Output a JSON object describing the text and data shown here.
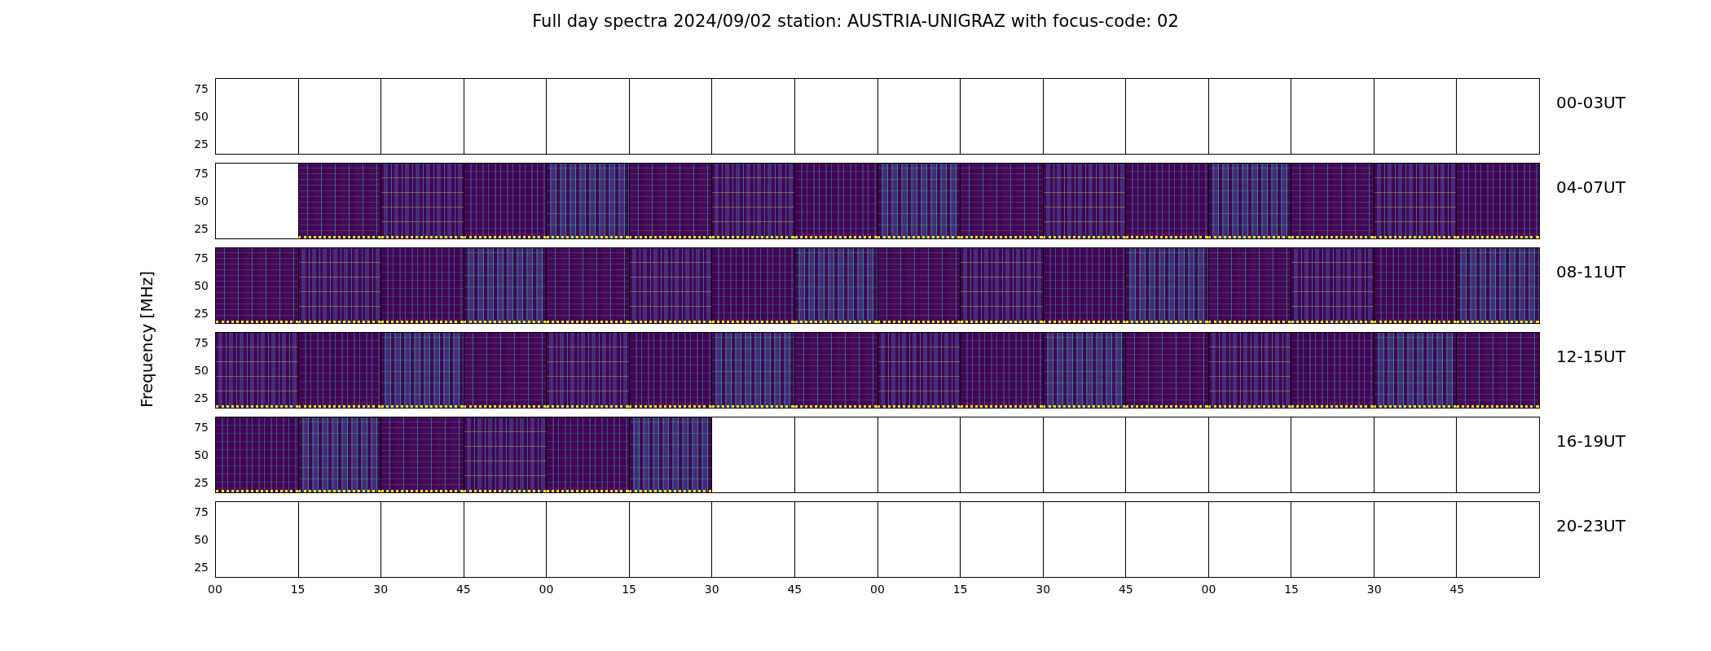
{
  "title": "Full day spectra 2024/09/02 station: AUSTRIA-UNIGRAZ with focus-code: 02",
  "ylabel": "Frequency [MHz]",
  "xticks": [
    "00",
    "15",
    "30",
    "45",
    "00",
    "15",
    "30",
    "45",
    "00",
    "15",
    "30",
    "45",
    "00",
    "15",
    "30",
    "45"
  ],
  "rows": [
    {
      "label": "00-03UT",
      "yticks": [
        "75",
        "50",
        "25"
      ],
      "panels": [
        false,
        false,
        false,
        false,
        false,
        false,
        false,
        false,
        false,
        false,
        false,
        false,
        false,
        false,
        false,
        false
      ]
    },
    {
      "label": "04-07UT",
      "yticks": [
        "75",
        "50",
        "25"
      ],
      "panels": [
        false,
        true,
        true,
        true,
        true,
        true,
        true,
        true,
        true,
        true,
        true,
        true,
        true,
        true,
        true,
        true
      ]
    },
    {
      "label": "08-11UT",
      "yticks": [
        "75",
        "50",
        "25"
      ],
      "panels": [
        true,
        true,
        true,
        true,
        true,
        true,
        true,
        true,
        true,
        true,
        true,
        true,
        true,
        true,
        true,
        true
      ]
    },
    {
      "label": "12-15UT",
      "yticks": [
        "75",
        "50",
        "25"
      ],
      "panels": [
        true,
        true,
        true,
        true,
        true,
        true,
        true,
        true,
        true,
        true,
        true,
        true,
        true,
        true,
        true,
        true
      ]
    },
    {
      "label": "16-19UT",
      "yticks": [
        "75",
        "50",
        "25"
      ],
      "panels": [
        true,
        true,
        true,
        true,
        true,
        true,
        false,
        false,
        false,
        false,
        false,
        false,
        false,
        false,
        false,
        false
      ]
    },
    {
      "label": "20-23UT",
      "yticks": [
        "75",
        "50",
        "25"
      ],
      "panels": [
        false,
        false,
        false,
        false,
        false,
        false,
        false,
        false,
        false,
        false,
        false,
        false,
        false,
        false,
        false,
        false
      ]
    }
  ]
}
